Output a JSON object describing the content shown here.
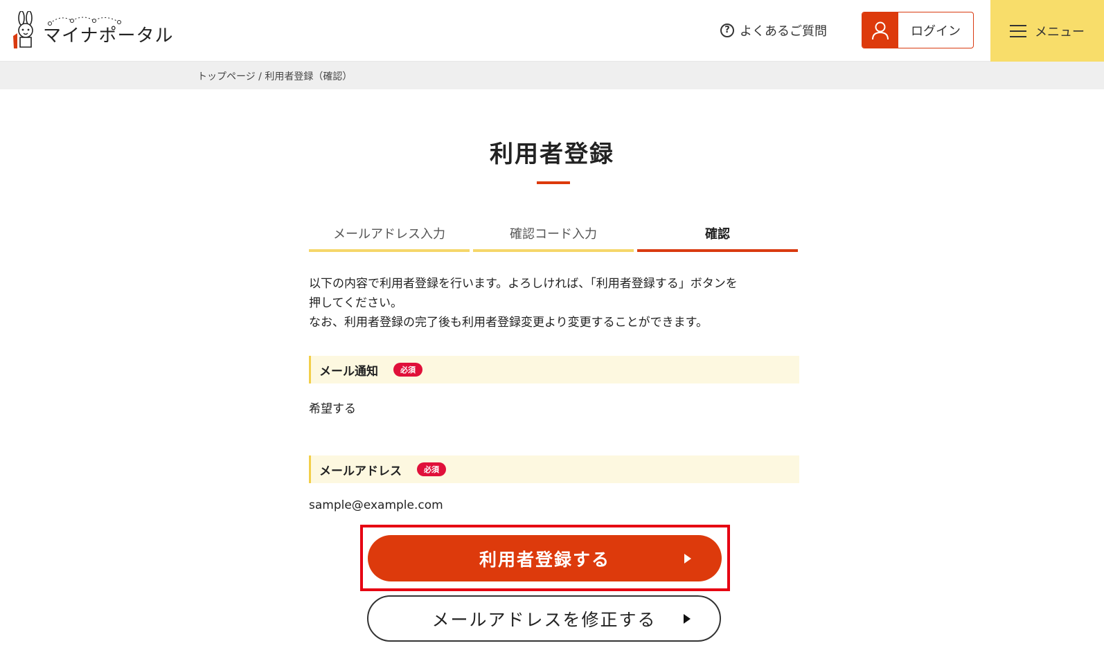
{
  "header": {
    "logo_text": "マイナポータル",
    "faq_label": "よくあるご質問",
    "login_label": "ログイン",
    "menu_label": "メニュー"
  },
  "breadcrumb": {
    "home": "トップページ",
    "separator": " / ",
    "current": "利用者登録（確認）"
  },
  "page": {
    "title": "利用者登録"
  },
  "steps": [
    {
      "label": "メールアドレス入力",
      "active": false
    },
    {
      "label": "確認コード入力",
      "active": false
    },
    {
      "label": "確認",
      "active": true
    }
  ],
  "intro": {
    "line1": "以下の内容で利用者登録を行います。よろしければ、「利用者登録する」ボタンを",
    "line2": "押してください。",
    "line3": "なお、利用者登録の完了後も利用者登録変更より変更することができます。"
  },
  "fields": [
    {
      "label": "メール通知",
      "badge": "必須",
      "value": "希望する"
    },
    {
      "label": "メールアドレス",
      "badge": "必須",
      "value": "sample@example.com"
    }
  ],
  "buttons": {
    "register": "利用者登録する",
    "edit_email": "メールアドレスを修正する"
  },
  "colors": {
    "accent": "#dd3a0c",
    "menu_bg": "#f8dd6a",
    "highlight": "#e60012",
    "required_badge": "#e0103a"
  }
}
